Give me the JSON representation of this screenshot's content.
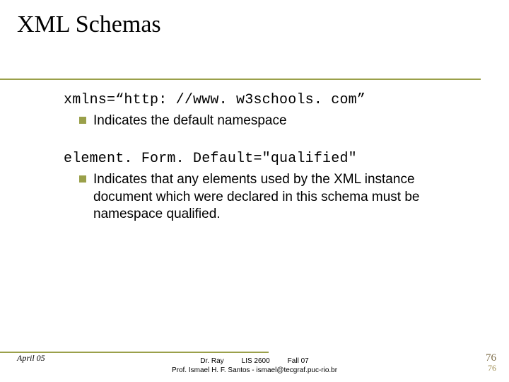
{
  "title": "XML Schemas",
  "body": {
    "item1": {
      "code": "xmlns=“http: //www. w3schools. com”",
      "text": "Indicates the default namespace"
    },
    "item2": {
      "code": "element. Form. Default=\"qualified\"",
      "text": "Indicates that any elements used by the XML instance document which were declared in this schema must be namespace qualified."
    }
  },
  "footer": {
    "left": "April 05",
    "center_line1": "Dr. Ray         LIS 2600         Fall 07",
    "center_line2": "Prof. Ismael H. F. Santos - ismael@tecgraf.puc-rio.br",
    "page_top": "76",
    "page_bot": "76"
  }
}
